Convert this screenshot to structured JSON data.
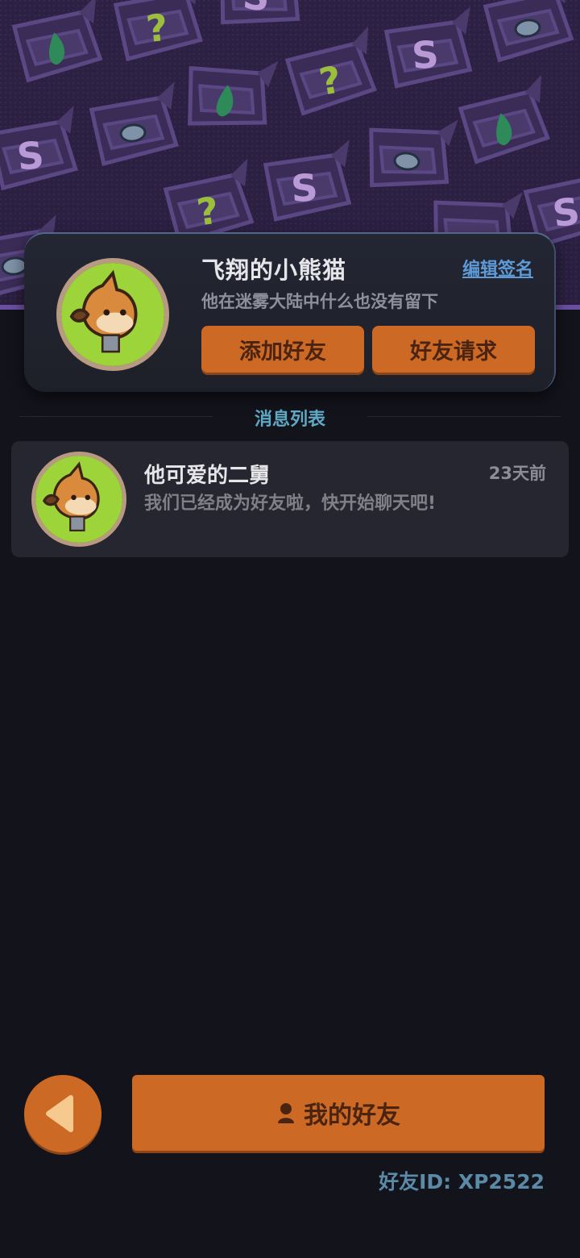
{
  "profile": {
    "username": "飞翔的小熊猫",
    "edit_signature_label": "编辑签名",
    "signature": "他在迷雾大陆中什么也没有留下",
    "add_friend_label": "添加好友",
    "friend_requests_label": "好友请求",
    "avatar_icon": "fox-avatar-icon"
  },
  "messages": {
    "section_title": "消息列表",
    "items": [
      {
        "name": "他可爱的二舅",
        "time": "23天前",
        "preview": "我们已经成为好友啦，快开始聊天吧!",
        "avatar_icon": "fox-avatar-icon"
      }
    ]
  },
  "footer": {
    "back_icon": "back-arrow-icon",
    "my_friends_label": "我的好友",
    "my_friends_icon": "person-icon",
    "friend_id_text": "好友ID: XP2522"
  },
  "colors": {
    "accent_orange": "#cc6a25",
    "banner_purple": "#2c2144",
    "link_blue": "#5e9ad6",
    "section_teal": "#5ea9c4",
    "background": "#13131c"
  }
}
